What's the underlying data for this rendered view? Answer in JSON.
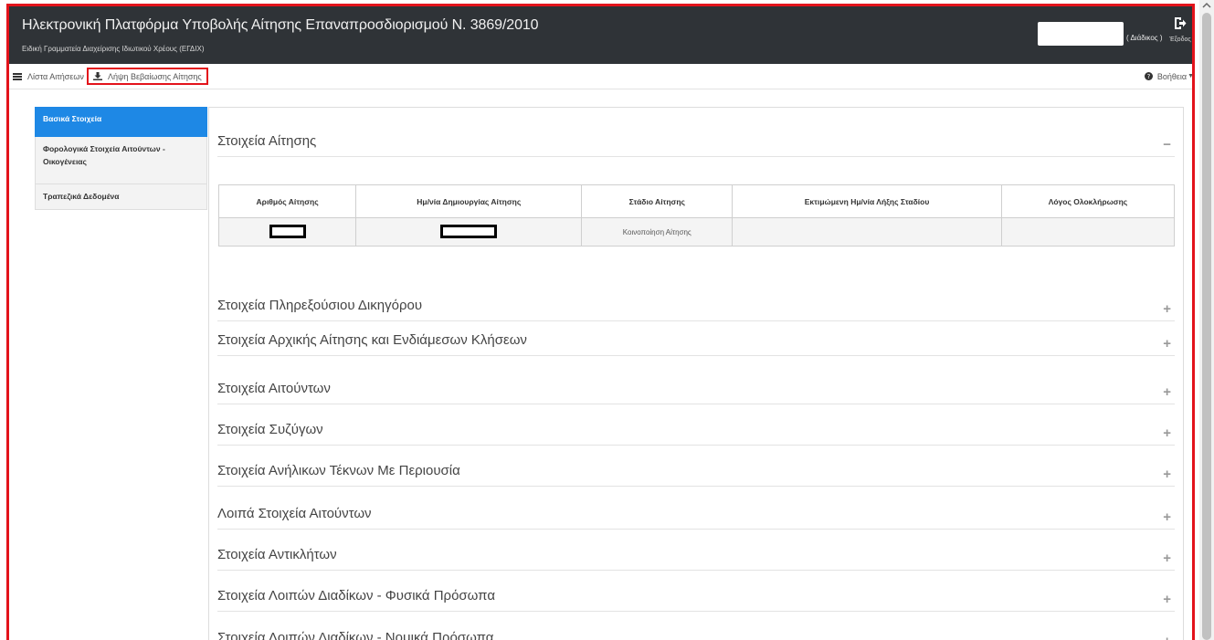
{
  "header": {
    "title": "Ηλεκτρονική Πλατφόρμα Υποβολής Αίτησης Επαναπροσδιορισμού Ν. 3869/2010",
    "subtitle": "Ειδική Γραμματεία Διαχείρισης Ιδιωτικού Χρέους (ΕΓΔΙΧ)",
    "user_role": "( Διάδικος )",
    "logout_label": "Έξοδος"
  },
  "toolbar": {
    "list_label": "Λίστα Αιτήσεων",
    "download_label": "Λήψη Βεβαίωσης Αίτησης",
    "help_label": "Βοήθεια"
  },
  "sidebar": {
    "items": [
      {
        "label": "Βασικά Στοιχεία"
      },
      {
        "label": "Φορολογικά Στοιχεία Αιτούντων - Οικογένειας"
      },
      {
        "label": "Τραπεζικά Δεδομένα"
      }
    ]
  },
  "main": {
    "section_title": "Στοιχεία Αίτησης",
    "collapse_symbol": "−",
    "table": {
      "headers": [
        "Αριθμός Αίτησης",
        "Ημ/νία Δημιουργίας Αίτησης",
        "Στάδιο Αίτησης",
        "Εκτιμώμενη Ημ/νία Λήξης Σταδίου",
        "Λόγος Ολοκλήρωσης"
      ],
      "row": {
        "stage": "Κοινοποίηση Αίτησης",
        "estimated_end": "",
        "completion_reason": ""
      }
    },
    "expand_symbol": "+",
    "sections": [
      "Στοιχεία Πληρεξούσιου Δικηγόρου",
      "Στοιχεία Αρχικής Αίτησης και Ενδιάμεσων Κλήσεων",
      "Στοιχεία Αιτούντων",
      "Στοιχεία Συζύγων",
      "Στοιχεία Ανήλικων Τέκνων Με Περιουσία",
      "Λοιπά Στοιχεία Αιτούντων",
      "Στοιχεία Αντικλήτων",
      "Στοιχεία Λοιπών Διαδίκων - Φυσικά Πρόσωπα",
      "Στοιχεία Λοιπών Διαδίκων - Νομικά Πρόσωπα"
    ]
  },
  "colors": {
    "header_bg": "#2f3337",
    "active_tab": "#1e88e5",
    "highlight_border": "#e3131b"
  }
}
